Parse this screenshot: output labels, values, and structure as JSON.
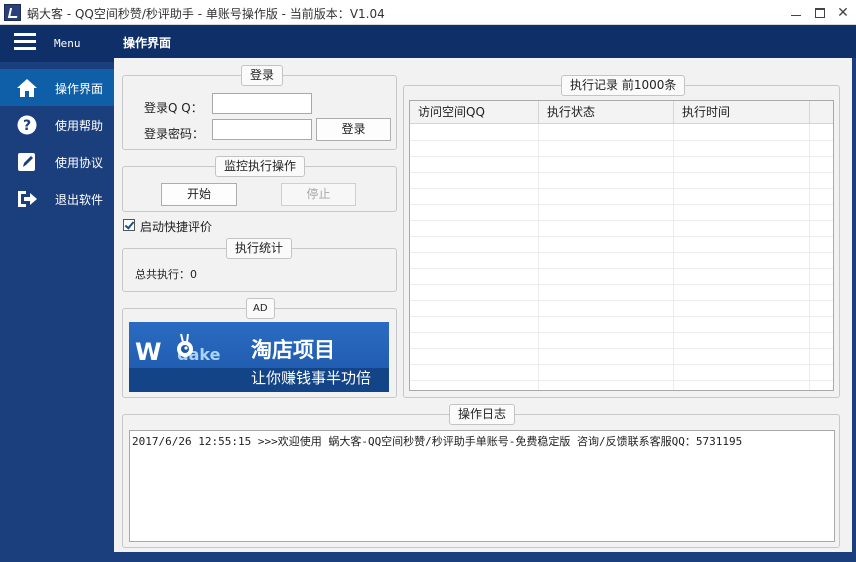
{
  "window": {
    "title": "蜗大客 - QQ空间秒赞/秒评助手 - 单账号操作版 - 当前版本：V1.04",
    "icon": "app-logo-icon"
  },
  "sidebar": {
    "menu_label": "Menu",
    "items": [
      {
        "label": "操作界面",
        "icon": "home-icon",
        "active": true
      },
      {
        "label": "使用帮助",
        "icon": "help-circle-icon",
        "active": false
      },
      {
        "label": "使用协议",
        "icon": "edit-pencil-icon",
        "active": false
      },
      {
        "label": "退出软件",
        "icon": "sign-out-icon",
        "active": false
      }
    ]
  },
  "header": {
    "title": "操作界面"
  },
  "login": {
    "group_title": "登录",
    "qq_label": "登录Q Q：",
    "qq_value": "",
    "password_label": "登录密码：",
    "password_value": "",
    "login_button": "登录"
  },
  "monitor": {
    "group_title": "监控执行操作",
    "start_button": "开始",
    "stop_button": "停止"
  },
  "quick_review": {
    "label": "启动快捷评价",
    "checked": true
  },
  "stats": {
    "group_title": "执行统计",
    "total_label": "总共执行：0"
  },
  "ad": {
    "group_title": "AD",
    "logo_w": "W",
    "logo_o": "o",
    "logo_dake": "dake",
    "headline": "淘店项目",
    "tagline": "让你赚钱事半功倍"
  },
  "records": {
    "group_title": "执行记录 前1000条",
    "columns": [
      "访问空间QQ",
      "执行状态",
      "执行时间"
    ],
    "rows": []
  },
  "log": {
    "group_title": "操作日志",
    "lines": [
      "2017/6/26 12:55:15 >>>欢迎使用 蜗大客-QQ空间秒赞/秒评助手单账号-免费稳定版  咨询/反馈联系客服QQ：5731195"
    ]
  },
  "colors": {
    "sidebar": "#1b3f7d",
    "header": "#0f2f68",
    "active_nav": "#0e5ea8",
    "content_bg": "#f2f2f2"
  }
}
